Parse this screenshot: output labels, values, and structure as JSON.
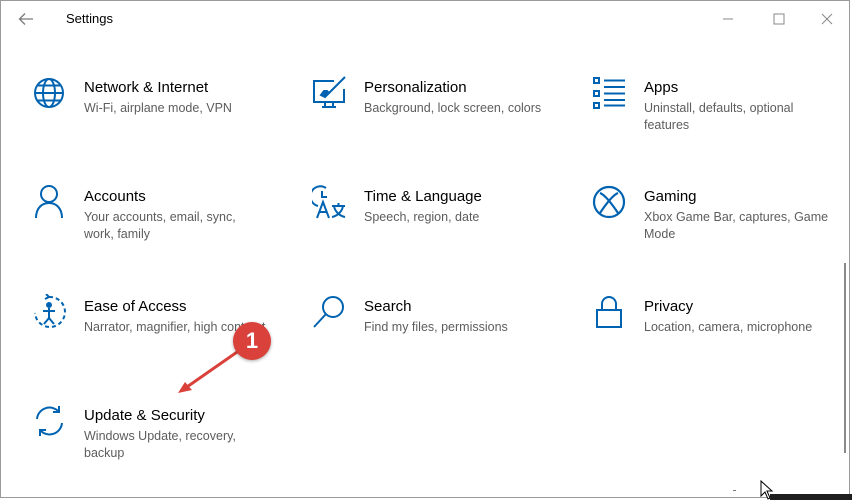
{
  "window": {
    "title": "Settings",
    "back_icon": "back-arrow-icon",
    "controls": [
      "minimize-icon",
      "maximize-icon",
      "close-icon"
    ]
  },
  "tiles": [
    {
      "name": "Network & Internet",
      "description": "Wi-Fi, airplane mode, VPN",
      "icon": "globe-icon"
    },
    {
      "name": "Personalization",
      "description": "Background, lock screen, colors",
      "icon": "personalization-icon"
    },
    {
      "name": "Apps",
      "description": "Uninstall, defaults, optional features",
      "icon": "apps-list-icon"
    },
    {
      "name": "Accounts",
      "description": "Your accounts, email, sync, work, family",
      "icon": "person-icon"
    },
    {
      "name": "Time & Language",
      "description": "Speech, region, date",
      "icon": "time-language-icon"
    },
    {
      "name": "Gaming",
      "description": "Xbox Game Bar, captures, Game Mode",
      "icon": "xbox-icon"
    },
    {
      "name": "Ease of Access",
      "description": "Narrator, magnifier, high contrast",
      "icon": "ease-of-access-icon"
    },
    {
      "name": "Search",
      "description": "Find my files, permissions",
      "icon": "search-icon"
    },
    {
      "name": "Privacy",
      "description": "Location, camera, microphone",
      "icon": "lock-icon"
    },
    {
      "name": "Update & Security",
      "description": "Windows Update, recovery, backup",
      "icon": "sync-icon"
    }
  ],
  "annotation": {
    "number": "1",
    "color": "#d9413a"
  },
  "colors": {
    "accent": "#0063b1",
    "title_text": "#000000",
    "desc_text": "#5d5d5d"
  }
}
